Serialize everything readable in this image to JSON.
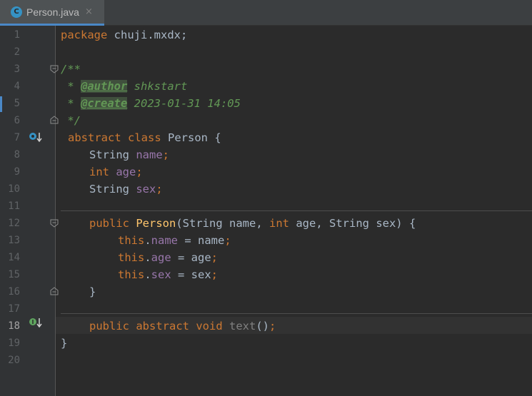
{
  "tab": {
    "title": "Person.java",
    "icon_letter": "C",
    "close": "×"
  },
  "current_line": 18,
  "colors": {
    "keyword": "#cc7832",
    "field": "#9876aa",
    "method": "#ffc66d",
    "comment": "#629755",
    "text": "#a9b7c6",
    "line_number": "#606366"
  },
  "line_numbers": [
    "1",
    "2",
    "3",
    "4",
    "5",
    "6",
    "7",
    "8",
    "9",
    "10",
    "11",
    "12",
    "13",
    "14",
    "15",
    "16",
    "17",
    "18",
    "19",
    "20"
  ],
  "gutter_icons": [
    {
      "line": 7,
      "name": "implemented-override-icon"
    },
    {
      "line": 18,
      "name": "implemented-method-icon"
    }
  ],
  "code": {
    "l1": {
      "kw": "package",
      "rest": " chuji.mxdx;"
    },
    "l3": {
      "c": "/**"
    },
    "l4": {
      "star": " * ",
      "tag": "@author",
      "val": " shkstart"
    },
    "l5": {
      "star": " * ",
      "tag": "@create",
      "val": " 2023-01-31 14:05"
    },
    "l6": {
      "c": " */"
    },
    "l7": {
      "kw1": "abstract",
      "kw2": "class",
      "name": "Person",
      "brace": "{"
    },
    "l8": {
      "type": "String",
      "field": "name",
      "semi": ";"
    },
    "l9": {
      "type": "int",
      "field": "age",
      "semi": ";"
    },
    "l10": {
      "type": "String",
      "field": "sex",
      "semi": ";"
    },
    "l12": {
      "kw": "public",
      "name": "Person",
      "p1": "(String name, ",
      "int": "int",
      "p2": " age, String sex) {"
    },
    "l13": {
      "this": "this",
      "dot": ".",
      "field": "name",
      "rest": " = name",
      "semi": ";"
    },
    "l14": {
      "this": "this",
      "dot": ".",
      "field": "age",
      "rest": " = age",
      "semi": ";"
    },
    "l15": {
      "this": "this",
      "dot": ".",
      "field": "sex",
      "rest": " = sex",
      "semi": ";"
    },
    "l16": {
      "brace": "}"
    },
    "l18": {
      "kw1": "public",
      "kw2": "abstract",
      "kw3": "void",
      "name": "text",
      "paren": "()",
      "semi": ";"
    },
    "l19": {
      "brace": "}"
    }
  }
}
